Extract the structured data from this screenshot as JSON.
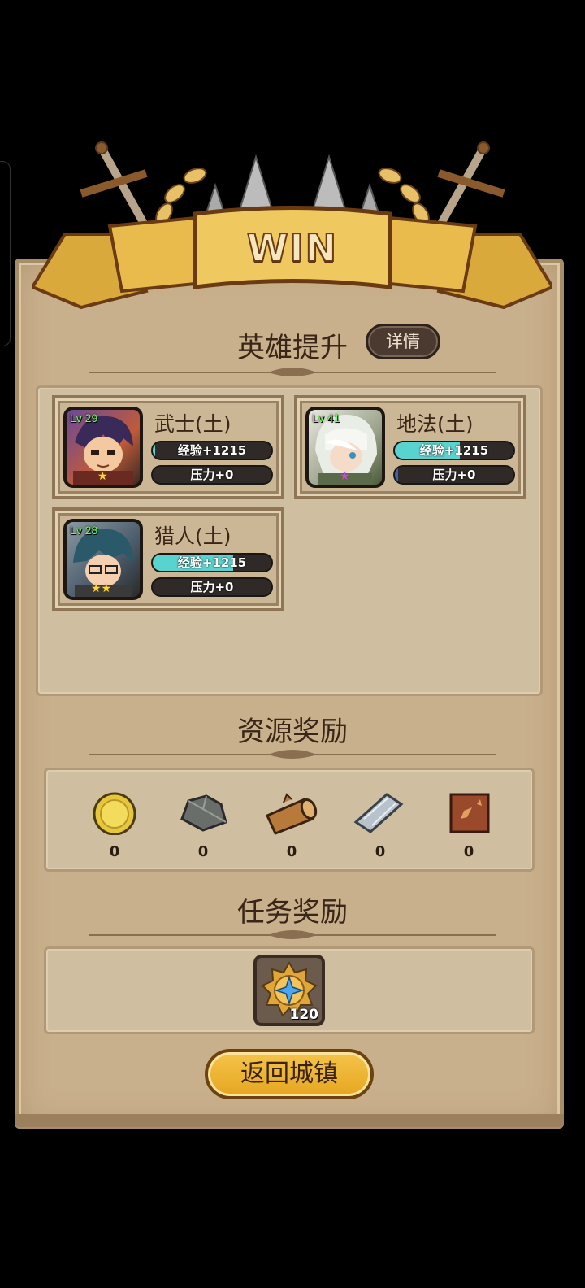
{
  "banner": {
    "title": "WIN"
  },
  "hero_section": {
    "title": "英雄提升",
    "detail_button": "详情",
    "heroes": [
      {
        "name": "武士(土)",
        "level": "Lv 29",
        "exp": "经验+1215",
        "exp_fill": 0.02,
        "stress": "压力+0",
        "stress_fill": 0,
        "stars": "★",
        "star_color": "gold"
      },
      {
        "name": "地法(土)",
        "level": "Lv 41",
        "exp": "经验+1215",
        "exp_fill": 0.55,
        "stress": "压力+0",
        "stress_fill": 0.03,
        "stars": "★",
        "star_color": "purple"
      },
      {
        "name": "猎人(土)",
        "level": "Lv 28",
        "exp": "经验+1215",
        "exp_fill": 0.68,
        "stress": "压力+0",
        "stress_fill": 0,
        "stars": "★★",
        "star_color": "gold"
      }
    ]
  },
  "resource_section": {
    "title": "资源奖励",
    "items": [
      {
        "icon": "gold-coin-icon",
        "count": "0"
      },
      {
        "icon": "stone-icon",
        "count": "0"
      },
      {
        "icon": "wood-log-icon",
        "count": "0"
      },
      {
        "icon": "iron-ingot-icon",
        "count": "0"
      },
      {
        "icon": "leather-hide-icon",
        "count": "0"
      }
    ]
  },
  "quest_section": {
    "title": "任务奖励",
    "reward": {
      "icon": "star-medal-icon",
      "count": "120"
    }
  },
  "return_button": "返回城镇",
  "colors": {
    "parchment": "#c9b08c",
    "exp_bar": "#59d3cf",
    "button_gold": "#f0b736"
  }
}
